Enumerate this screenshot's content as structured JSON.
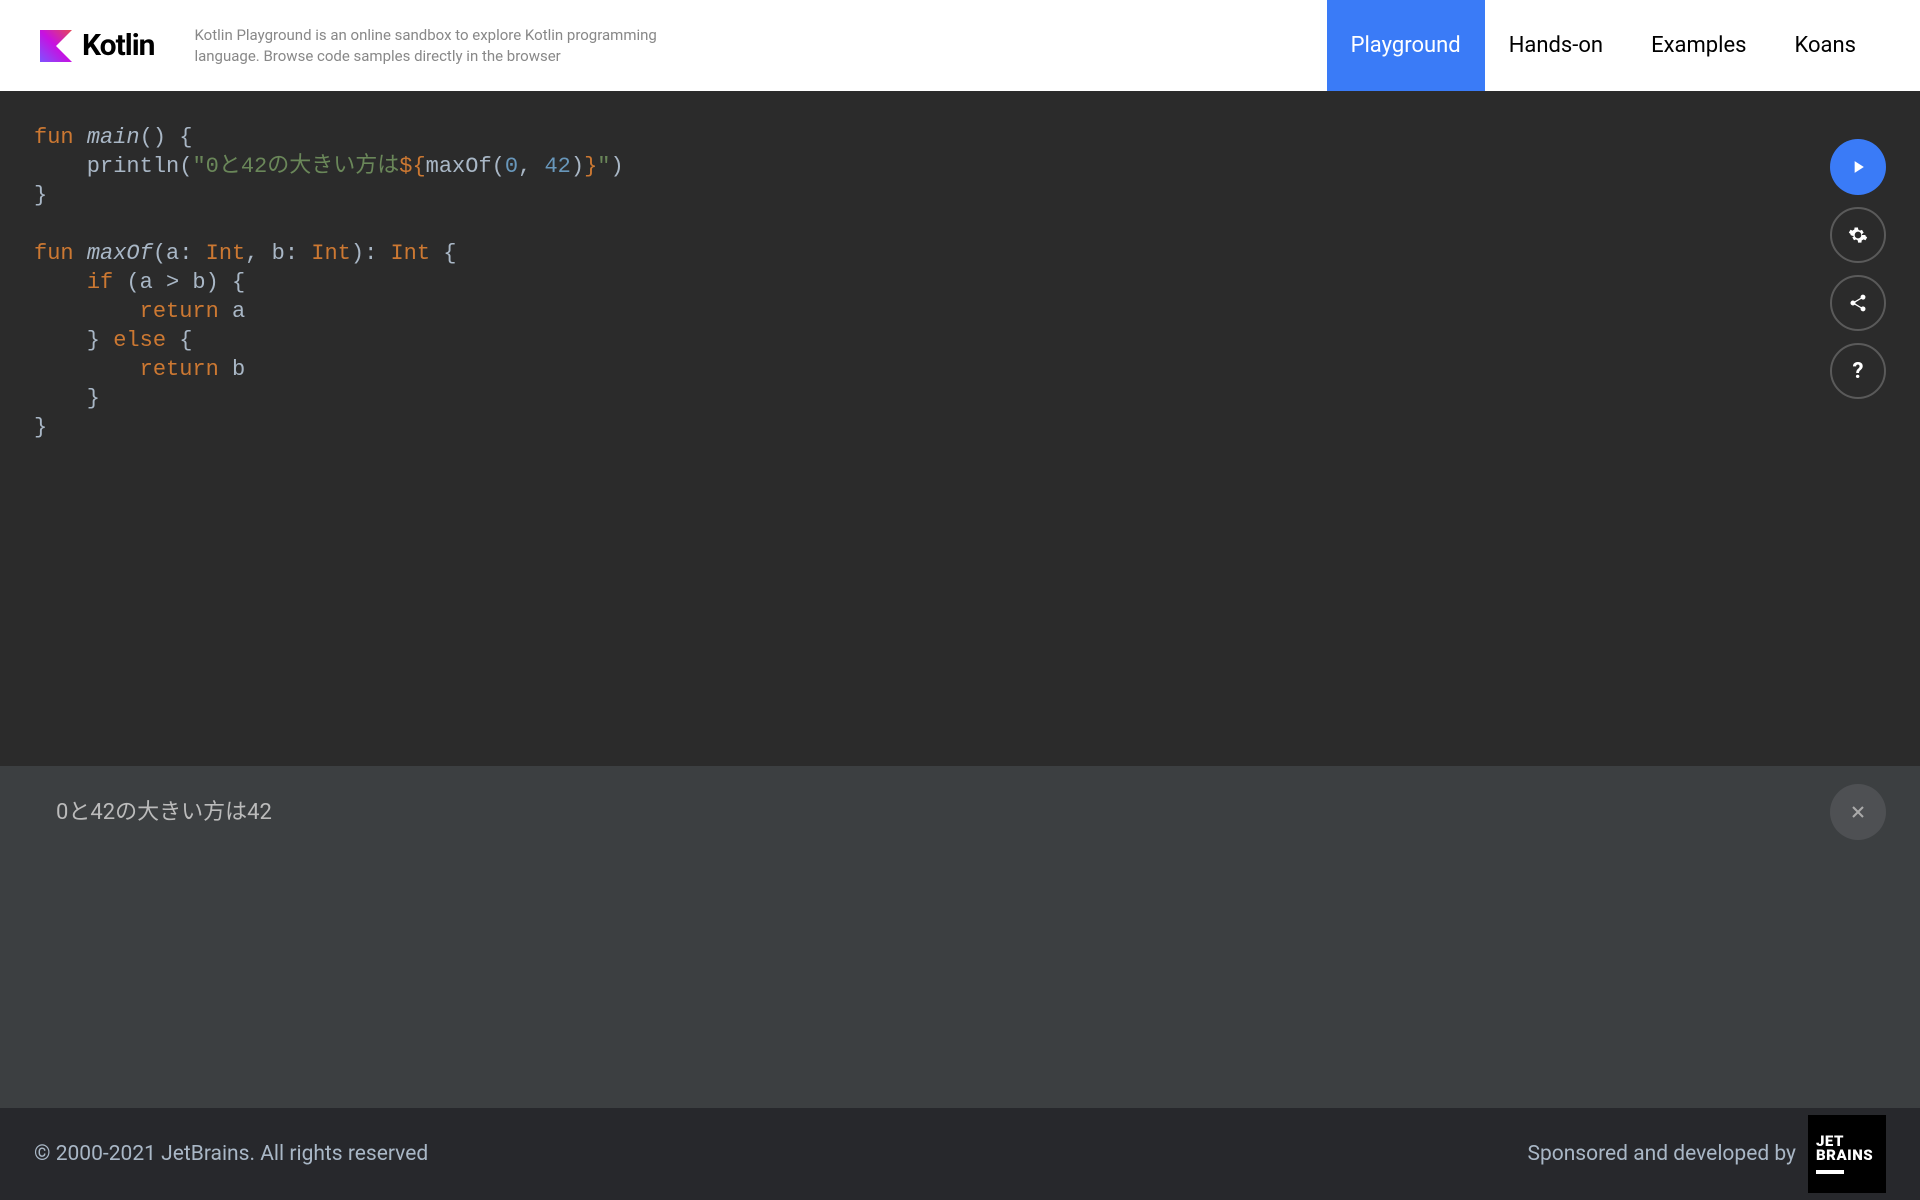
{
  "header": {
    "logo_text": "Kotlin",
    "description": "Kotlin Playground is an online sandbox to explore Kotlin programming language. Browse code samples directly in the browser",
    "nav": [
      {
        "label": "Playground",
        "active": true
      },
      {
        "label": "Hands-on",
        "active": false
      },
      {
        "label": "Examples",
        "active": false
      },
      {
        "label": "Koans",
        "active": false
      }
    ]
  },
  "code": {
    "line1_kw": "fun",
    "line1_fn": "main",
    "line1_rest": "() {",
    "line2_indent": "    println(",
    "line2_str1": "\"0と42の大きい方は",
    "line2_tmpl_open": "${",
    "line2_call": "maxOf(",
    "line2_n1": "0",
    "line2_comma": ", ",
    "line2_n2": "42",
    "line2_call_close": ")",
    "line2_tmpl_close": "}",
    "line2_str2": "\"",
    "line2_rest": ")",
    "line3": "}",
    "line5_kw": "fun",
    "line5_fn": "maxOf",
    "line5_open": "(a: ",
    "line5_type1": "Int",
    "line5_mid": ", b: ",
    "line5_type2": "Int",
    "line5_ret": "): ",
    "line5_type3": "Int",
    "line5_brace": " {",
    "line6_indent": "    ",
    "line6_kw": "if",
    "line6_rest": " (a > b) {",
    "line7_indent": "        ",
    "line7_kw": "return",
    "line7_rest": " a",
    "line8": "    } ",
    "line8_kw": "else",
    "line8_rest": " {",
    "line9_indent": "        ",
    "line9_kw": "return",
    "line9_rest": " b",
    "line10": "    }",
    "line11": "}"
  },
  "actions": {
    "run": "play-icon",
    "settings": "gear-icon",
    "share": "share-icon",
    "help": "question-icon",
    "help_char": "?"
  },
  "output": {
    "text": "0と42の大きい方は42"
  },
  "footer": {
    "copyright": "© 2000-2021 JetBrains. All rights reserved",
    "sponsor_text": "Sponsored and developed by",
    "jetbrains_line1": "JET",
    "jetbrains_line2": "BRAINS"
  }
}
